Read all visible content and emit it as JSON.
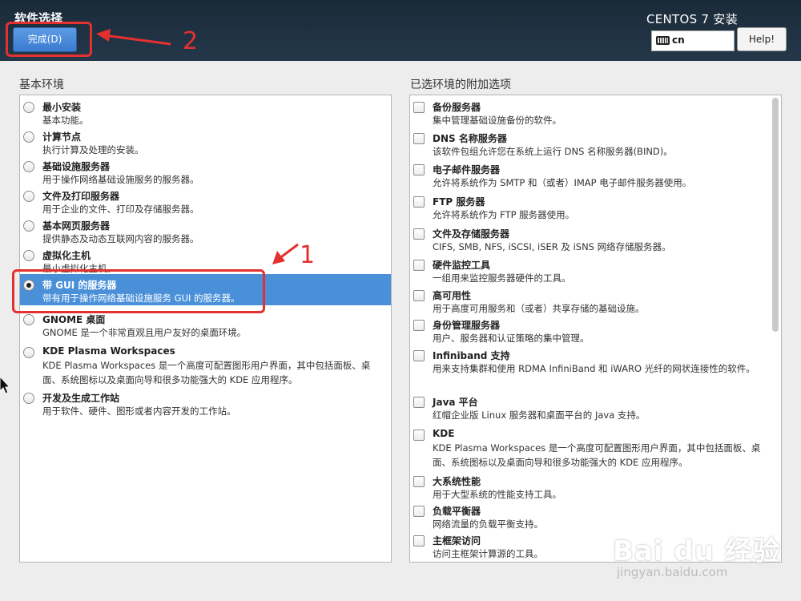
{
  "header": {
    "spoke_title": "软件选择",
    "done_label": "完成(D)",
    "product_title": "CENTOS 7 安装",
    "keyboard_layout": "cn",
    "help_label": "Help!"
  },
  "left_column": {
    "title": "基本环境",
    "environments": [
      {
        "name": "最小安装",
        "desc": "基本功能。",
        "selected": false
      },
      {
        "name": "计算节点",
        "desc": "执行计算及处理的安装。",
        "selected": false
      },
      {
        "name": "基础设施服务器",
        "desc": "用于操作网络基础设施服务的服务器。",
        "selected": false
      },
      {
        "name": "文件及打印服务器",
        "desc": "用于企业的文件、打印及存储服务器。",
        "selected": false
      },
      {
        "name": "基本网页服务器",
        "desc": "提供静态及动态互联网内容的服务器。",
        "selected": false
      },
      {
        "name": "虚拟化主机",
        "desc": "最小虚拟化主机。",
        "selected": false
      },
      {
        "name": "带 GUI 的服务器",
        "desc": "带有用于操作网络基础设施服务 GUI 的服务器。",
        "selected": true
      },
      {
        "name": "GNOME 桌面",
        "desc": "GNOME 是一个非常直观且用户友好的桌面环境。",
        "selected": false
      },
      {
        "name": "KDE Plasma Workspaces",
        "desc": "KDE Plasma Workspaces 是一个高度可配置图形用户界面，其中包括面板、桌面、系统图标以及桌面向导和很多功能强大的 KDE 应用程序。",
        "selected": false
      },
      {
        "name": "开发及生成工作站",
        "desc": "用于软件、硬件、图形或者内容开发的工作站。",
        "selected": false
      }
    ]
  },
  "right_column": {
    "title": "已选环境的附加选项",
    "addons": [
      {
        "name": "备份服务器",
        "desc": "集中管理基础设施备份的软件。"
      },
      {
        "name": "DNS 名称服务器",
        "desc": "该软件包组允许您在系统上运行 DNS 名称服务器(BIND)。"
      },
      {
        "name": "电子邮件服务器",
        "desc": "允许将系统作为 SMTP 和（或者）IMAP 电子邮件服务器使用。"
      },
      {
        "name": "FTP 服务器",
        "desc": "允许将系统作为 FTP 服务器使用。"
      },
      {
        "name": "文件及存储服务器",
        "desc": "CIFS, SMB, NFS, iSCSI, iSER 及 iSNS 网络存储服务器。"
      },
      {
        "name": "硬件监控工具",
        "desc": "一组用来监控服务器硬件的工具。"
      },
      {
        "name": "高可用性",
        "desc": "用于高度可用服务和（或者）共享存储的基础设施。"
      },
      {
        "name": "身份管理服务器",
        "desc": "用户、服务器和认证策略的集中管理。"
      },
      {
        "name": "Infiniband 支持",
        "desc": "用来支持集群和使用 RDMA InfiniBand 和 iWARO 光纤的网状连接性的软件。"
      },
      {
        "name": "Java 平台",
        "desc": "红帽企业版 Linux 服务器和桌面平台的 Java 支持。"
      },
      {
        "name": "KDE",
        "desc": "KDE Plasma Workspaces 是一个高度可配置图形用户界面，其中包括面板、桌面、系统图标以及桌面向导和很多功能强大的 KDE 应用程序。"
      },
      {
        "name": "大系统性能",
        "desc": "用于大型系统的性能支持工具。"
      },
      {
        "name": "负载平衡器",
        "desc": "网络流量的负载平衡支持。"
      },
      {
        "name": "主框架访问",
        "desc": "访问主框架计算源的工具。"
      }
    ]
  },
  "annotations": {
    "label_1": "1",
    "label_2": "2",
    "color": "#e53030"
  },
  "watermark": {
    "logo": "Bai du 经验",
    "url": "jingyan.baidu.com"
  },
  "colors": {
    "header_bg": "#1f3142",
    "selected_bg": "#4a90d9",
    "done_button": "#4a8bd8"
  }
}
